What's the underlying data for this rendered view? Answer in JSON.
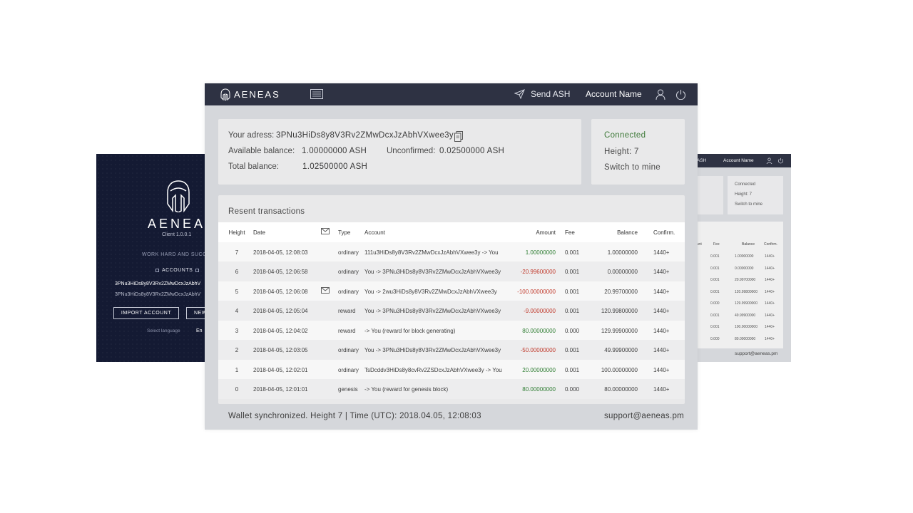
{
  "login_window": {
    "brand": "AENEAS",
    "version": "Client 1.0.0.1",
    "tagline": "WORK HARD AND SUCC",
    "accounts_label": "ACCOUNTS",
    "addresses": [
      "3PNu3HiDs8y8V3Rv2ZMwDcxJzAbhV",
      "3PNu3HiDs8y8V3Rv2ZMwDcxJzAbhV"
    ],
    "import_button": "IMPORT ACCOUNT",
    "new_button": "NEW",
    "language_label": "Select language",
    "language_value": "En"
  },
  "mini_window": {
    "send_label": "d ASH",
    "account_name": "Account Name",
    "status": {
      "connected": "Connected",
      "height": "Height: 7",
      "switch": "Switch to mine"
    },
    "headers": [
      "ount",
      "Fee",
      "Balance",
      "Confirm."
    ],
    "rows": [
      {
        "amt": "0000",
        "fee": "0.001",
        "bal": "1.00000000",
        "cf": "1440+",
        "neg": false
      },
      {
        "amt": "0000",
        "fee": "0.001",
        "bal": "0.00000000",
        "cf": "1440+",
        "neg": true
      },
      {
        "amt": "0000",
        "fee": "0.001",
        "bal": "20.99700000",
        "cf": "1440+",
        "neg": true
      },
      {
        "amt": "0000",
        "fee": "0.001",
        "bal": "120.99800000",
        "cf": "1440+",
        "neg": true
      },
      {
        "amt": "0000",
        "fee": "0.000",
        "bal": "129.99900000",
        "cf": "1440+",
        "neg": false
      },
      {
        "amt": "0000",
        "fee": "0.001",
        "bal": "49.99900000",
        "cf": "1440+",
        "neg": true
      },
      {
        "amt": "0000",
        "fee": "0.001",
        "bal": "100.00000000",
        "cf": "1440+",
        "neg": false
      },
      {
        "amt": "0000",
        "fee": "0.000",
        "bal": "80.00000000",
        "cf": "1440+",
        "neg": false
      }
    ],
    "support": "support@aeneas.pm"
  },
  "topbar": {
    "brand": "AENEAS",
    "send_label": "Send ASH",
    "account_name": "Account Name"
  },
  "wallet": {
    "address_label": "Your adress:",
    "address": "3PNu3HiDs8y8V3Rv2ZMwDcxJzAbhVXwee3y",
    "available_label": "Available balance:",
    "available_value": "1.00000000 ASH",
    "unconfirmed_label": "Unconfirmed:",
    "unconfirmed_value": "0.02500000 ASH",
    "total_label": "Total balance:",
    "total_value": "1.02500000 ASH"
  },
  "status": {
    "connected": "Connected",
    "height": "Height: 7",
    "switch": "Switch to mine"
  },
  "transactions": {
    "title": "Resent transactions",
    "headers": {
      "height": "Height",
      "date": "Date",
      "type": "Type",
      "account": "Account",
      "amount": "Amount",
      "fee": "Fee",
      "balance": "Balance",
      "confirm": "Confirm."
    },
    "rows": [
      {
        "height": "7",
        "date": "2018-04-05, 12:08:03",
        "mail": false,
        "type": "ordinary",
        "account": "111u3HiDs8y8V3Rv2ZMwDcxJzAbhVXwee3y -> You",
        "amount": "1.00000000",
        "sign": "pos",
        "fee": "0.001",
        "balance": "1.00000000",
        "confirm": "1440+"
      },
      {
        "height": "6",
        "date": "2018-04-05, 12:06:58",
        "mail": false,
        "type": "ordinary",
        "account": "You -> 3PNu3HiDs8y8V3Rv2ZMwDcxJzAbhVXwee3y",
        "amount": "-20.99600000",
        "sign": "neg",
        "fee": "0.001",
        "balance": "0.00000000",
        "confirm": "1440+"
      },
      {
        "height": "5",
        "date": "2018-04-05, 12:06:08",
        "mail": true,
        "type": "ordinary",
        "account": "You -> 2wu3HiDs8y8V3Rv2ZMwDcxJzAbhVXwee3y",
        "amount": "-100.00000000",
        "sign": "neg",
        "fee": "0.001",
        "balance": "20.99700000",
        "confirm": "1440+"
      },
      {
        "height": "4",
        "date": "2018-04-05, 12:05:04",
        "mail": false,
        "type": "reward",
        "account": "You -> 3PNu3HiDs8y8V3Rv2ZMwDcxJzAbhVXwee3y",
        "amount": "-9.00000000",
        "sign": "neg",
        "fee": "0.001",
        "balance": "120.99800000",
        "confirm": "1440+"
      },
      {
        "height": "3",
        "date": "2018-04-05, 12:04:02",
        "mail": false,
        "type": "reward",
        "account": "-> You (reward for block generating)",
        "amount": "80.00000000",
        "sign": "pos",
        "fee": "0.000",
        "balance": "129.99900000",
        "confirm": "1440+"
      },
      {
        "height": "2",
        "date": "2018-04-05, 12:03:05",
        "mail": false,
        "type": "ordinary",
        "account": "You -> 3PNu3HiDs8y8V3Rv2ZMwDcxJzAbhVXwee3y",
        "amount": "-50.00000000",
        "sign": "neg",
        "fee": "0.001",
        "balance": "49.99900000",
        "confirm": "1440+"
      },
      {
        "height": "1",
        "date": "2018-04-05, 12:02:01",
        "mail": false,
        "type": "ordinary",
        "account": "TsDcddv3HiDs8y8cvRv2ZSDcxJzAbhVXwee3y -> You",
        "amount": "20.00000000",
        "sign": "pos",
        "fee": "0.001",
        "balance": "100.00000000",
        "confirm": "1440+"
      },
      {
        "height": "0",
        "date": "2018-04-05, 12:01:01",
        "mail": false,
        "type": "genesis",
        "account": "-> You (reward for genesis block)",
        "amount": "80.00000000",
        "sign": "pos",
        "fee": "0.000",
        "balance": "80.00000000",
        "confirm": "1440+"
      }
    ]
  },
  "footer": {
    "sync": "Wallet synchronized. Height 7 | Time (UTC): 2018.04.05, 12:08:03",
    "support": "support@aeneas.pm"
  },
  "colors": {
    "topbar": "#2e3243",
    "negative": "#c0392b",
    "positive": "#2e7d32",
    "connected": "#3f7a3a",
    "login_bg": "#141a33"
  }
}
